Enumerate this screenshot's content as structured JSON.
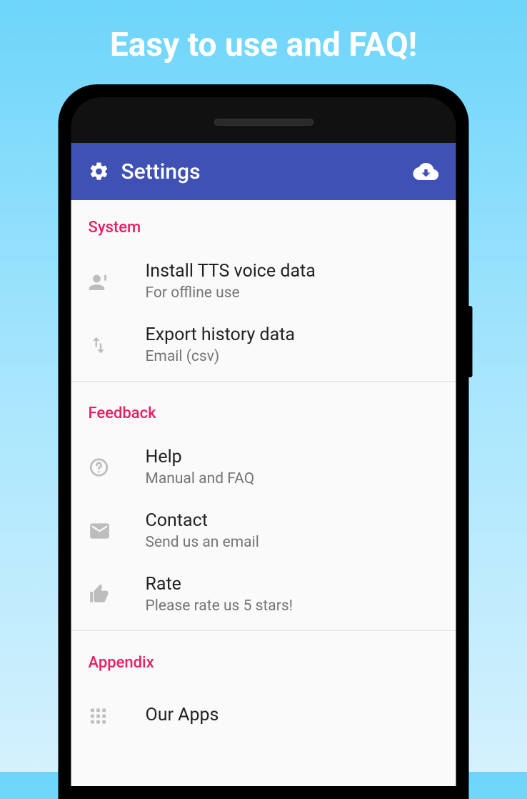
{
  "hero": "Easy to use and FAQ!",
  "appbar": {
    "title": "Settings"
  },
  "sections": {
    "system": {
      "header": "System",
      "items": [
        {
          "title": "Install TTS voice data",
          "sub": "For offline use"
        },
        {
          "title": "Export history data",
          "sub": "Email (csv)"
        }
      ]
    },
    "feedback": {
      "header": "Feedback",
      "items": [
        {
          "title": "Help",
          "sub": "Manual and FAQ"
        },
        {
          "title": "Contact",
          "sub": "Send us an email"
        },
        {
          "title": "Rate",
          "sub": "Please rate us 5 stars!"
        }
      ]
    },
    "appendix": {
      "header": "Appendix",
      "items": [
        {
          "title": "Our Apps",
          "sub": ""
        }
      ]
    }
  }
}
